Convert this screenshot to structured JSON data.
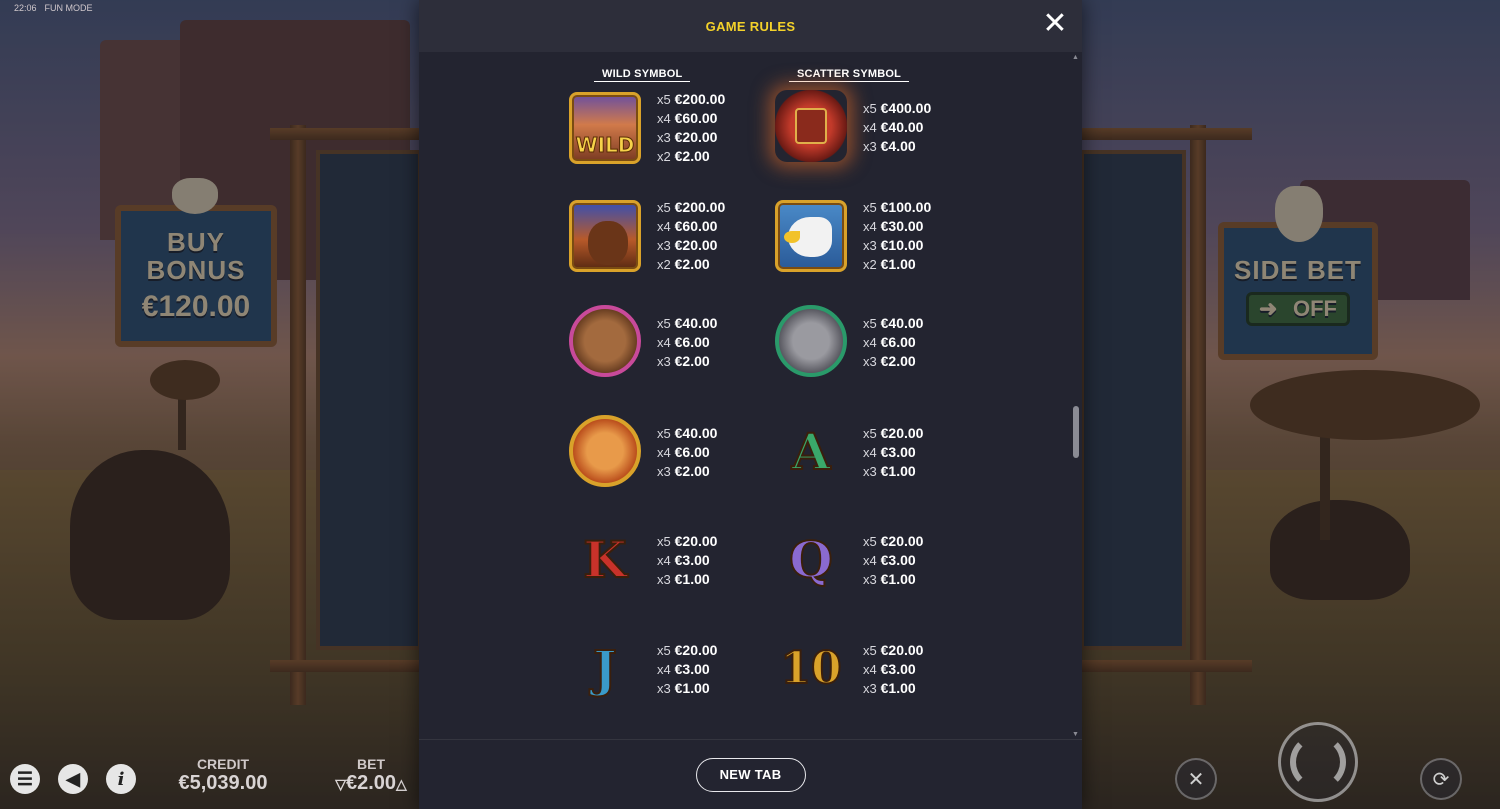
{
  "status_bar": {
    "time": "22:06",
    "mode": "FUN MODE"
  },
  "game": {
    "buy_bonus": {
      "line1": "BUY",
      "line2": "BONUS",
      "price": "€120.00"
    },
    "side_bet": {
      "label": "SIDE BET",
      "state": "OFF"
    },
    "credit": {
      "label": "CREDIT",
      "value": "€5,039.00"
    },
    "bet": {
      "label": "BET",
      "value": "€2.00"
    }
  },
  "modal": {
    "title": "GAME RULES",
    "close_icon": "close-icon",
    "columns": {
      "wild_title": "WILD SYMBOL",
      "scatter_title": "SCATTER SYMBOL"
    },
    "rows": [
      {
        "left": {
          "symbol": "wild",
          "label": "WILD",
          "pays": [
            [
              "x5",
              "€200.00"
            ],
            [
              "x4",
              "€60.00"
            ],
            [
              "x3",
              "€20.00"
            ],
            [
              "x2",
              "€2.00"
            ]
          ]
        },
        "right": {
          "symbol": "scatter-book",
          "pays": [
            [
              "x5",
              "€400.00"
            ],
            [
              "x4",
              "€40.00"
            ],
            [
              "x3",
              "€4.00"
            ]
          ]
        }
      },
      {
        "left": {
          "symbol": "bison",
          "pays": [
            [
              "x5",
              "€200.00"
            ],
            [
              "x4",
              "€60.00"
            ],
            [
              "x3",
              "€20.00"
            ],
            [
              "x2",
              "€2.00"
            ]
          ]
        },
        "right": {
          "symbol": "eagle",
          "pays": [
            [
              "x5",
              "€100.00"
            ],
            [
              "x4",
              "€30.00"
            ],
            [
              "x3",
              "€10.00"
            ],
            [
              "x2",
              "€1.00"
            ]
          ]
        }
      },
      {
        "left": {
          "symbol": "bear",
          "pays": [
            [
              "x5",
              "€40.00"
            ],
            [
              "x4",
              "€6.00"
            ],
            [
              "x3",
              "€2.00"
            ]
          ]
        },
        "right": {
          "symbol": "wolf",
          "pays": [
            [
              "x5",
              "€40.00"
            ],
            [
              "x4",
              "€6.00"
            ],
            [
              "x3",
              "€2.00"
            ]
          ]
        }
      },
      {
        "left": {
          "symbol": "cougar",
          "pays": [
            [
              "x5",
              "€40.00"
            ],
            [
              "x4",
              "€6.00"
            ],
            [
              "x3",
              "€2.00"
            ]
          ]
        },
        "right": {
          "symbol": "letter-a",
          "label": "A",
          "pays": [
            [
              "x5",
              "€20.00"
            ],
            [
              "x4",
              "€3.00"
            ],
            [
              "x3",
              "€1.00"
            ]
          ]
        }
      },
      {
        "left": {
          "symbol": "letter-k",
          "label": "K",
          "pays": [
            [
              "x5",
              "€20.00"
            ],
            [
              "x4",
              "€3.00"
            ],
            [
              "x3",
              "€1.00"
            ]
          ]
        },
        "right": {
          "symbol": "letter-q",
          "label": "Q",
          "pays": [
            [
              "x5",
              "€20.00"
            ],
            [
              "x4",
              "€3.00"
            ],
            [
              "x3",
              "€1.00"
            ]
          ]
        }
      },
      {
        "left": {
          "symbol": "letter-j",
          "label": "J",
          "pays": [
            [
              "x5",
              "€20.00"
            ],
            [
              "x4",
              "€3.00"
            ],
            [
              "x3",
              "€1.00"
            ]
          ]
        },
        "right": {
          "symbol": "ten",
          "label": "10",
          "pays": [
            [
              "x5",
              "€20.00"
            ],
            [
              "x4",
              "€3.00"
            ],
            [
              "x3",
              "€1.00"
            ]
          ]
        }
      }
    ],
    "new_tab_label": "NEW TAB"
  },
  "colors": {
    "modal_bg": "#232430",
    "title_yellow": "#f4d22a",
    "gold_frame": "#d9a22a"
  }
}
